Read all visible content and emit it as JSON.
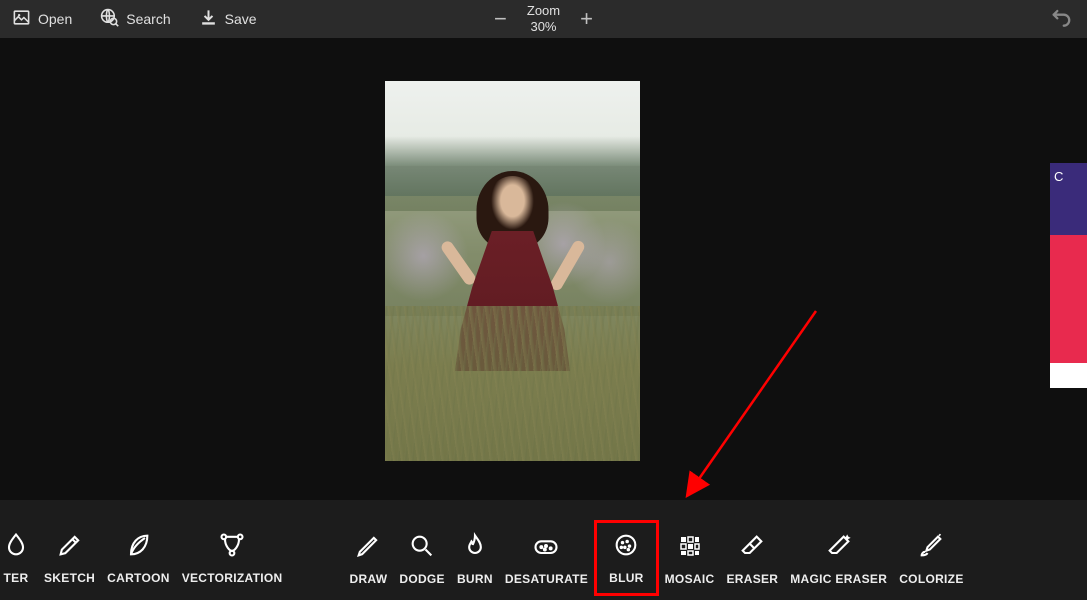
{
  "topbar": {
    "open_label": "Open",
    "search_label": "Search",
    "save_label": "Save",
    "zoom_label": "Zoom",
    "zoom_value": "30%"
  },
  "tools_left": [
    {
      "id": "ter",
      "label": "TER"
    },
    {
      "id": "sketch",
      "label": "SKETCH"
    },
    {
      "id": "cartoon",
      "label": "CARTOON"
    },
    {
      "id": "vectorization",
      "label": "VECTORIZATION"
    }
  ],
  "tools_right": [
    {
      "id": "draw",
      "label": "DRAW"
    },
    {
      "id": "dodge",
      "label": "DODGE"
    },
    {
      "id": "burn",
      "label": "BURN"
    },
    {
      "id": "desaturate",
      "label": "DESATURATE"
    },
    {
      "id": "blur",
      "label": "BLUR",
      "highlighted": true
    },
    {
      "id": "mosaic",
      "label": "MOSAIC"
    },
    {
      "id": "eraser",
      "label": "ERASER"
    },
    {
      "id": "magic-eraser",
      "label": "MAGIC ERASER"
    },
    {
      "id": "colorize",
      "label": "COLORIZE"
    }
  ],
  "side_ad": {
    "text": "C"
  }
}
